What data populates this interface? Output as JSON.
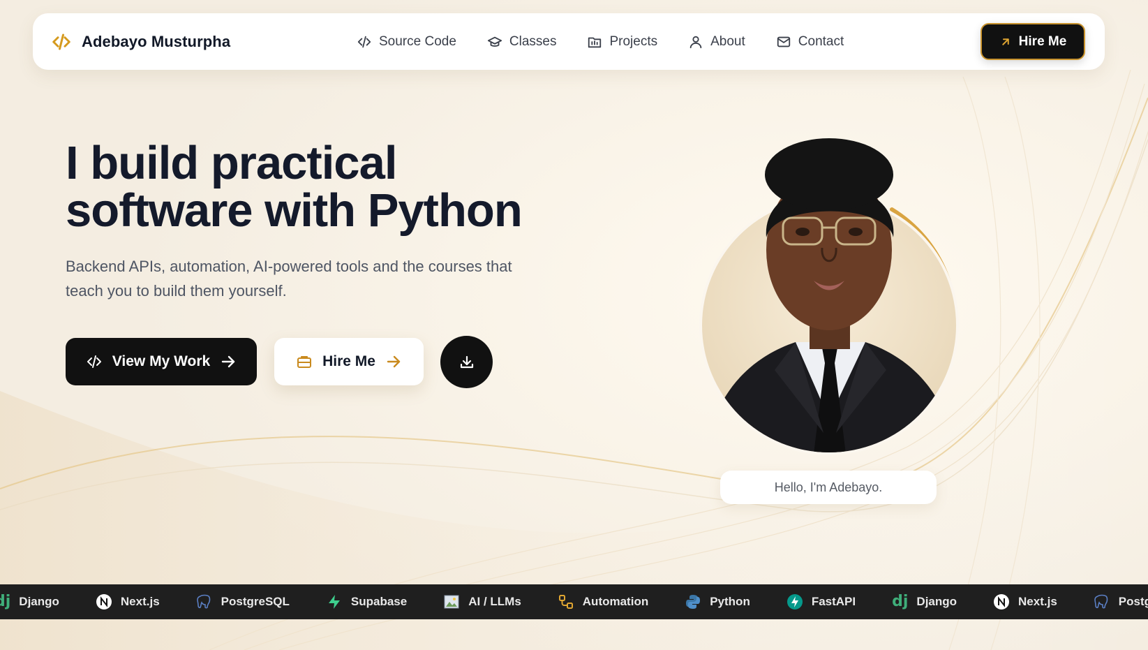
{
  "brand": {
    "name": "Adebayo Musturpha",
    "icon": "code-brackets-icon",
    "accent": "#d59a1e"
  },
  "nav": {
    "items": [
      {
        "label": "Source Code",
        "icon": "code-icon"
      },
      {
        "label": "Classes",
        "icon": "graduation-cap-icon"
      },
      {
        "label": "Projects",
        "icon": "folder-chart-icon"
      },
      {
        "label": "About",
        "icon": "user-icon"
      },
      {
        "label": "Contact",
        "icon": "mail-icon"
      }
    ],
    "cta_label": "Hire Me",
    "cta_icon": "arrow-up-right-icon"
  },
  "hero": {
    "title_line1": "I build practical",
    "title_line2": "software with Python",
    "subtitle": "Backend APIs, automation, AI-powered tools and the courses that teach you to build them yourself.",
    "primary_button": "View My Work",
    "secondary_button": "Hire Me",
    "download_icon": "download-icon",
    "greeting": "Hello, I'm Adebayo."
  },
  "tech_strip": {
    "items": [
      {
        "label": "Django",
        "icon": "django-icon"
      },
      {
        "label": "Next.js",
        "icon": "nextjs-icon"
      },
      {
        "label": "PostgreSQL",
        "icon": "postgresql-icon"
      },
      {
        "label": "Supabase",
        "icon": "supabase-icon"
      },
      {
        "label": "AI / LLMs",
        "icon": "image-icon"
      },
      {
        "label": "Automation",
        "icon": "workflow-icon"
      },
      {
        "label": "Python",
        "icon": "python-icon"
      },
      {
        "label": "FastAPI",
        "icon": "fastapi-icon"
      },
      {
        "label": "Django",
        "icon": "django-icon"
      },
      {
        "label": "Next.js",
        "icon": "nextjs-icon"
      },
      {
        "label": "PostgreSQL",
        "icon": "postgresql-icon"
      }
    ]
  },
  "colors": {
    "background": "#f7f3ec",
    "dark": "#111111",
    "gold": "#d59a1e",
    "strip": "#1f1f1f"
  }
}
